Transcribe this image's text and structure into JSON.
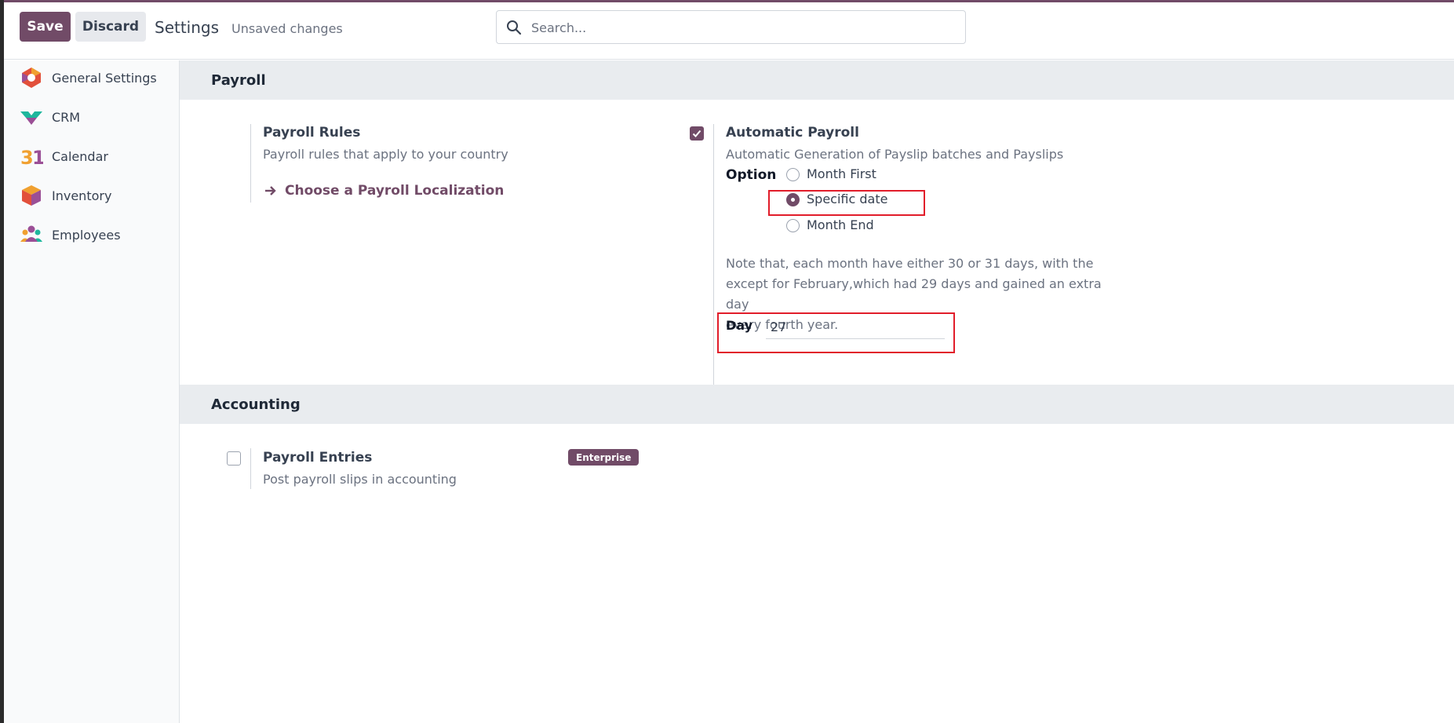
{
  "toolbar": {
    "save_label": "Save",
    "discard_label": "Discard",
    "title": "Settings",
    "status": "Unsaved changes"
  },
  "search": {
    "placeholder": "Search..."
  },
  "sidebar": {
    "items": [
      {
        "label": "General Settings",
        "icon": "odoo-hexagon-icon"
      },
      {
        "label": "CRM",
        "icon": "crm-icon"
      },
      {
        "label": "Calendar",
        "icon": "calendar-31-icon"
      },
      {
        "label": "Inventory",
        "icon": "inventory-box-icon"
      },
      {
        "label": "Employees",
        "icon": "employees-icon"
      }
    ]
  },
  "payroll_section": {
    "title": "Payroll",
    "rules": {
      "title": "Payroll Rules",
      "desc": "Payroll rules that apply to your country",
      "link": "Choose a Payroll Localization"
    },
    "automatic": {
      "checked": true,
      "title": "Automatic Payroll",
      "desc": "Automatic Generation of Payslip batches and Payslips",
      "option_label": "Option",
      "options": [
        "Month First",
        "Specific date",
        "Month End"
      ],
      "selected": "Specific date",
      "note_lines": [
        "Note that, each month have either 30 or 31 days, with the",
        "except for February,which had 29 days and gained an extra day",
        "every fourth year."
      ],
      "day_label": "Day",
      "day_value": "27"
    }
  },
  "accounting_section": {
    "title": "Accounting",
    "entries": {
      "checked": false,
      "title": "Payroll Entries",
      "desc": "Post payroll slips in accounting",
      "badge": "Enterprise"
    }
  },
  "colors": {
    "brand": "#714B67",
    "highlight": "#e11d2a",
    "section_bg": "#e9ecef"
  }
}
